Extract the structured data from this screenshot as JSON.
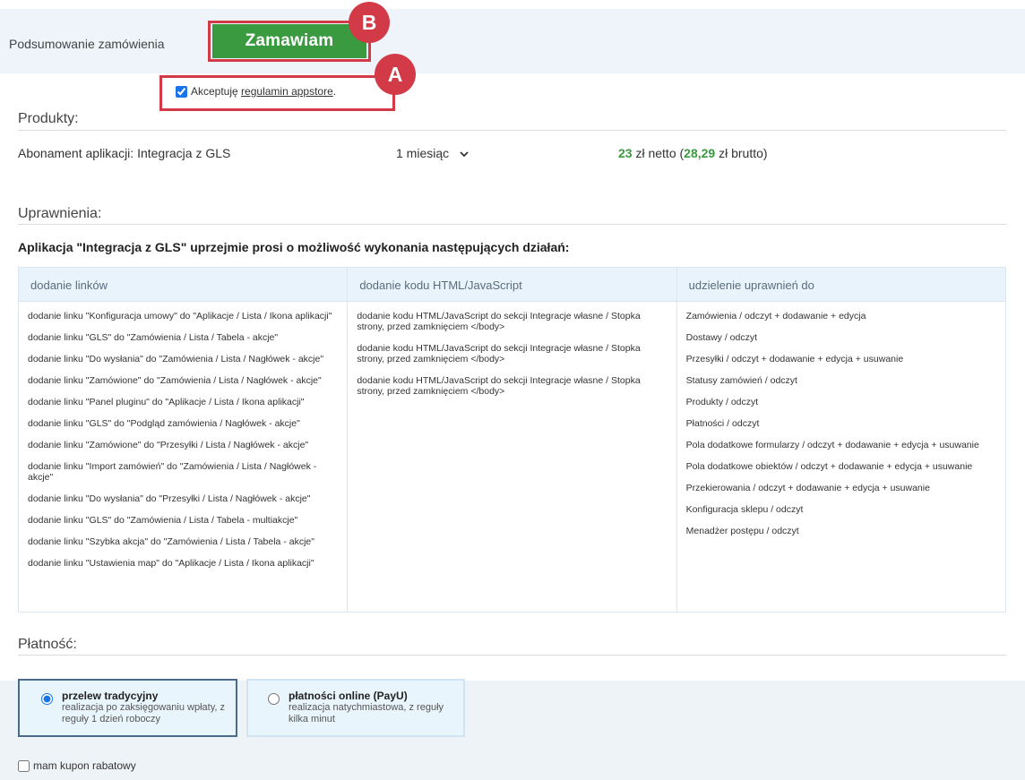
{
  "header": {
    "summary_label": "Podsumowanie zamówienia",
    "order_button": "Zamawiam",
    "badge_b": "B",
    "badge_a": "A"
  },
  "accept": {
    "prefix": "Akceptuję ",
    "link": "regulamin appstore",
    "suffix": "."
  },
  "products": {
    "title": "Produkty:",
    "name": "Abonament aplikacji: Integracja z GLS",
    "period": "1 miesiąc",
    "price_net_value": "23",
    "price_net_suffix": " zł netto (",
    "price_gross_value": "28,29",
    "price_gross_suffix": " zł brutto)"
  },
  "permissions": {
    "title": "Uprawnienia:",
    "heading": "Aplikacja \"Integracja z GLS\" uprzejmie prosi o możliwość wykonania następujących działań:",
    "columns": [
      {
        "header": "dodanie linków",
        "items": [
          "dodanie linku \"Konfiguracja umowy\" do \"Aplikacje / Lista / Ikona aplikacji\"",
          "dodanie linku \"GLS\" do \"Zamówienia / Lista / Tabela - akcje\"",
          "dodanie linku \"Do wysłania\" do \"Zamówienia / Lista / Nagłówek - akcje\"",
          "dodanie linku \"Zamówione\" do \"Zamówienia / Lista / Nagłówek - akcje\"",
          "dodanie linku \"Panel pluginu\" do \"Aplikacje / Lista / Ikona aplikacji\"",
          "dodanie linku \"GLS\" do \"Podgląd zamówienia / Nagłówek - akcje\"",
          "dodanie linku \"Zamówione\" do \"Przesyłki / Lista / Nagłówek - akcje\"",
          "dodanie linku \"Import zamówień\" do \"Zamówienia / Lista / Nagłówek - akcje\"",
          "dodanie linku \"Do wysłania\" do \"Przesyłki / Lista / Nagłówek - akcje\"",
          "dodanie linku \"GLS\" do \"Zamówienia / Lista / Tabela - multiakcje\"",
          "dodanie linku \"Szybka akcja\" do \"Zamówienia / Lista / Tabela - akcje\"",
          "dodanie linku \"Ustawienia map\" do \"Aplikacje / Lista / Ikona aplikacji\""
        ]
      },
      {
        "header": "dodanie kodu HTML/JavaScript",
        "items": [
          "dodanie kodu HTML/JavaScript do sekcji Integracje własne / Stopka strony, przed zamknięciem </body>",
          "dodanie kodu HTML/JavaScript do sekcji Integracje własne / Stopka strony, przed zamknięciem </body>",
          "dodanie kodu HTML/JavaScript do sekcji Integracje własne / Stopka strony, przed zamknięciem </body>"
        ]
      },
      {
        "header": "udzielenie uprawnień do",
        "items": [
          "Zamówienia / odczyt + dodawanie + edycja",
          "Dostawy / odczyt",
          "Przesyłki / odczyt + dodawanie + edycja + usuwanie",
          "Statusy zamówień / odczyt",
          "Produkty / odczyt",
          "Płatności / odczyt",
          "Pola dodatkowe formularzy / odczyt + dodawanie + edycja + usuwanie",
          "Pola dodatkowe obiektów / odczyt + dodawanie + edycja + usuwanie",
          "Przekierowania / odczyt + dodawanie + edycja + usuwanie",
          "Konfiguracja sklepu / odczyt",
          "Menadżer postępu / odczyt"
        ]
      }
    ]
  },
  "payment": {
    "title": "Płatność:",
    "options": [
      {
        "title": "przelew tradycyjny",
        "desc": "realizacja po zaksięgowaniu wpłaty, z reguły 1 dzień roboczy",
        "selected": true
      },
      {
        "title": "płatności online (PayU)",
        "desc": "realizacja natychmiastowa, z reguły kilka minut",
        "selected": false
      }
    ],
    "coupon_label": "mam kupon rabatowy"
  }
}
